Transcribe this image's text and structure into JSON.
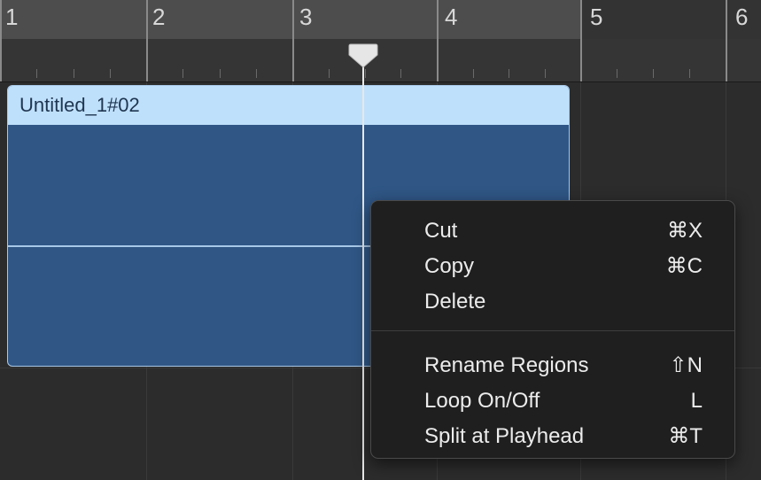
{
  "ruler": {
    "bars": [
      "1",
      "2",
      "3",
      "4",
      "5",
      "6"
    ]
  },
  "region": {
    "name": "Untitled_1#02"
  },
  "context_menu": {
    "items": [
      {
        "label": "Cut",
        "shortcut": "⌘X"
      },
      {
        "label": "Copy",
        "shortcut": "⌘C"
      },
      {
        "label": "Delete",
        "shortcut": ""
      },
      {
        "label": "Rename Regions",
        "shortcut": "⇧N"
      },
      {
        "label": "Loop On/Off",
        "shortcut": "L"
      },
      {
        "label": "Split at Playhead",
        "shortcut": "⌘T"
      }
    ]
  },
  "colors": {
    "region_header": "#bfe0fb",
    "region_body": "#2f5685",
    "menu_bg": "#1f1f1f",
    "playhead": "#e8e8e8"
  }
}
